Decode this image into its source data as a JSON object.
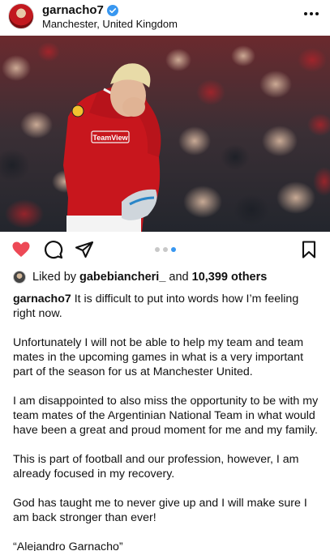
{
  "header": {
    "username": "garnacho7",
    "location": "Manchester, United Kingdom",
    "verified_color": "#3897f0"
  },
  "photo": {
    "jersey_text": "TeamView"
  },
  "actions": {
    "carousel_active_index": 3,
    "carousel_count": 3,
    "like_color": "#ed4956"
  },
  "likes": {
    "prefix": "Liked by ",
    "user": "gabebiancheri_",
    "middle": " and ",
    "others": "10,399 others"
  },
  "caption": {
    "username": "garnacho7",
    "first": " It is difficult to put into words how I’m feeling right now.",
    "paragraphs": [
      "Unfortunately I will not be able to help my team and team mates in the upcoming games in what is a very important part of the season for us at Manchester United.",
      "I am disappointed to also miss the opportunity to be with my team mates of the Argentinian National Team in what would have been a great and proud moment for me and my family.",
      "This is part of football and our profession, however, I am already focused in my recovery.",
      "God has taught me to never give up and I will make sure I am back stronger than ever!",
      "“Alejandro Garnacho”"
    ]
  }
}
